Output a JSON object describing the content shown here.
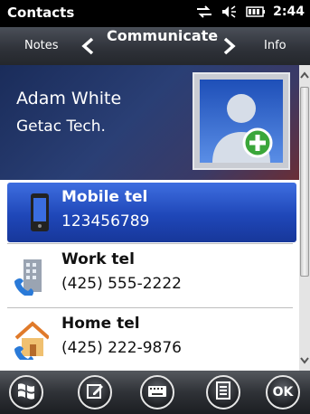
{
  "status_bar": {
    "app_title": "Contacts",
    "time": "2:44",
    "icons": [
      "sync-arrows-icon",
      "speaker-icon",
      "battery-icon"
    ]
  },
  "tabs": {
    "left": "Notes",
    "current": "Communicate",
    "right": "Info"
  },
  "contact": {
    "name": "Adam White",
    "company": "Getac Tech.",
    "photo_icon": "add-contact-photo-icon"
  },
  "entries": [
    {
      "label": "Mobile tel",
      "value": "123456789",
      "icon": "mobile-phone-icon",
      "selected": true
    },
    {
      "label": "Work tel",
      "value": "(425) 555-2222",
      "icon": "work-building-phone-icon",
      "selected": false
    },
    {
      "label": "Home tel",
      "value": "(425) 222-9876",
      "icon": "home-phone-icon",
      "selected": false
    }
  ],
  "bottom_bar": {
    "buttons": [
      "windows-start-icon",
      "edit-icon",
      "keyboard-icon",
      "menu-icon"
    ],
    "ok_label": "OK"
  },
  "colors": {
    "selection": "#2a52c8",
    "status_bar": "#000000",
    "header_blue": "#1a2c5a"
  }
}
